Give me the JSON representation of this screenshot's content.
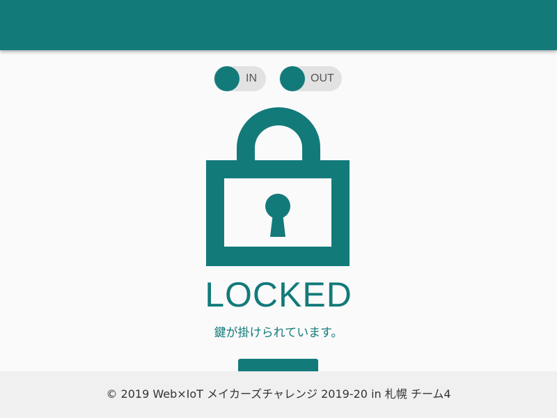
{
  "toggles": {
    "in": {
      "label": "IN"
    },
    "out": {
      "label": "OUT"
    }
  },
  "lock": {
    "icon": "padlock-locked-icon",
    "status": "LOCKED",
    "message": "鍵が掛けられています。"
  },
  "footer": {
    "copyright": "© 2019 Web×IoT メイカーズチャレンジ 2019-20 in 札幌 チーム4"
  },
  "colors": {
    "accent": "#137a7a",
    "background": "#fafafa",
    "toggle_track": "#e2e2e2",
    "footer_bg": "#f0f0f0"
  }
}
